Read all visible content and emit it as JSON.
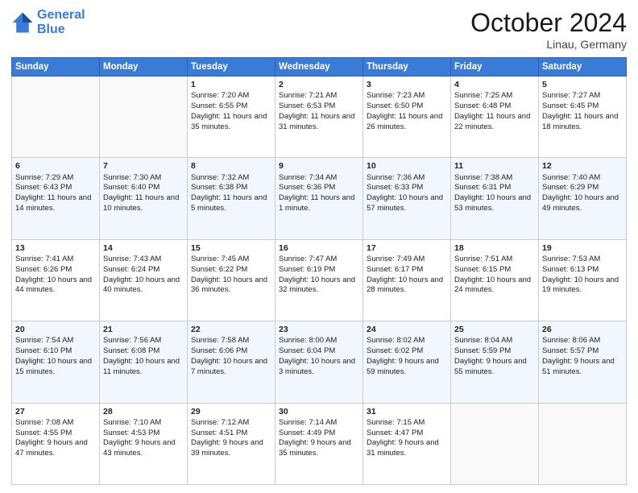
{
  "header": {
    "logo_line1": "General",
    "logo_line2": "Blue",
    "month": "October 2024",
    "location": "Linau, Germany"
  },
  "days_of_week": [
    "Sunday",
    "Monday",
    "Tuesday",
    "Wednesday",
    "Thursday",
    "Friday",
    "Saturday"
  ],
  "weeks": [
    [
      {
        "day": "",
        "sunrise": "",
        "sunset": "",
        "daylight": ""
      },
      {
        "day": "",
        "sunrise": "",
        "sunset": "",
        "daylight": ""
      },
      {
        "day": "1",
        "sunrise": "Sunrise: 7:20 AM",
        "sunset": "Sunset: 6:55 PM",
        "daylight": "Daylight: 11 hours and 35 minutes."
      },
      {
        "day": "2",
        "sunrise": "Sunrise: 7:21 AM",
        "sunset": "Sunset: 6:53 PM",
        "daylight": "Daylight: 11 hours and 31 minutes."
      },
      {
        "day": "3",
        "sunrise": "Sunrise: 7:23 AM",
        "sunset": "Sunset: 6:50 PM",
        "daylight": "Daylight: 11 hours and 26 minutes."
      },
      {
        "day": "4",
        "sunrise": "Sunrise: 7:25 AM",
        "sunset": "Sunset: 6:48 PM",
        "daylight": "Daylight: 11 hours and 22 minutes."
      },
      {
        "day": "5",
        "sunrise": "Sunrise: 7:27 AM",
        "sunset": "Sunset: 6:45 PM",
        "daylight": "Daylight: 11 hours and 18 minutes."
      }
    ],
    [
      {
        "day": "6",
        "sunrise": "Sunrise: 7:29 AM",
        "sunset": "Sunset: 6:43 PM",
        "daylight": "Daylight: 11 hours and 14 minutes."
      },
      {
        "day": "7",
        "sunrise": "Sunrise: 7:30 AM",
        "sunset": "Sunset: 6:40 PM",
        "daylight": "Daylight: 11 hours and 10 minutes."
      },
      {
        "day": "8",
        "sunrise": "Sunrise: 7:32 AM",
        "sunset": "Sunset: 6:38 PM",
        "daylight": "Daylight: 11 hours and 5 minutes."
      },
      {
        "day": "9",
        "sunrise": "Sunrise: 7:34 AM",
        "sunset": "Sunset: 6:36 PM",
        "daylight": "Daylight: 11 hours and 1 minute."
      },
      {
        "day": "10",
        "sunrise": "Sunrise: 7:36 AM",
        "sunset": "Sunset: 6:33 PM",
        "daylight": "Daylight: 10 hours and 57 minutes."
      },
      {
        "day": "11",
        "sunrise": "Sunrise: 7:38 AM",
        "sunset": "Sunset: 6:31 PM",
        "daylight": "Daylight: 10 hours and 53 minutes."
      },
      {
        "day": "12",
        "sunrise": "Sunrise: 7:40 AM",
        "sunset": "Sunset: 6:29 PM",
        "daylight": "Daylight: 10 hours and 49 minutes."
      }
    ],
    [
      {
        "day": "13",
        "sunrise": "Sunrise: 7:41 AM",
        "sunset": "Sunset: 6:26 PM",
        "daylight": "Daylight: 10 hours and 44 minutes."
      },
      {
        "day": "14",
        "sunrise": "Sunrise: 7:43 AM",
        "sunset": "Sunset: 6:24 PM",
        "daylight": "Daylight: 10 hours and 40 minutes."
      },
      {
        "day": "15",
        "sunrise": "Sunrise: 7:45 AM",
        "sunset": "Sunset: 6:22 PM",
        "daylight": "Daylight: 10 hours and 36 minutes."
      },
      {
        "day": "16",
        "sunrise": "Sunrise: 7:47 AM",
        "sunset": "Sunset: 6:19 PM",
        "daylight": "Daylight: 10 hours and 32 minutes."
      },
      {
        "day": "17",
        "sunrise": "Sunrise: 7:49 AM",
        "sunset": "Sunset: 6:17 PM",
        "daylight": "Daylight: 10 hours and 28 minutes."
      },
      {
        "day": "18",
        "sunrise": "Sunrise: 7:51 AM",
        "sunset": "Sunset: 6:15 PM",
        "daylight": "Daylight: 10 hours and 24 minutes."
      },
      {
        "day": "19",
        "sunrise": "Sunrise: 7:53 AM",
        "sunset": "Sunset: 6:13 PM",
        "daylight": "Daylight: 10 hours and 19 minutes."
      }
    ],
    [
      {
        "day": "20",
        "sunrise": "Sunrise: 7:54 AM",
        "sunset": "Sunset: 6:10 PM",
        "daylight": "Daylight: 10 hours and 15 minutes."
      },
      {
        "day": "21",
        "sunrise": "Sunrise: 7:56 AM",
        "sunset": "Sunset: 6:08 PM",
        "daylight": "Daylight: 10 hours and 11 minutes."
      },
      {
        "day": "22",
        "sunrise": "Sunrise: 7:58 AM",
        "sunset": "Sunset: 6:06 PM",
        "daylight": "Daylight: 10 hours and 7 minutes."
      },
      {
        "day": "23",
        "sunrise": "Sunrise: 8:00 AM",
        "sunset": "Sunset: 6:04 PM",
        "daylight": "Daylight: 10 hours and 3 minutes."
      },
      {
        "day": "24",
        "sunrise": "Sunrise: 8:02 AM",
        "sunset": "Sunset: 6:02 PM",
        "daylight": "Daylight: 9 hours and 59 minutes."
      },
      {
        "day": "25",
        "sunrise": "Sunrise: 8:04 AM",
        "sunset": "Sunset: 5:59 PM",
        "daylight": "Daylight: 9 hours and 55 minutes."
      },
      {
        "day": "26",
        "sunrise": "Sunrise: 8:06 AM",
        "sunset": "Sunset: 5:57 PM",
        "daylight": "Daylight: 9 hours and 51 minutes."
      }
    ],
    [
      {
        "day": "27",
        "sunrise": "Sunrise: 7:08 AM",
        "sunset": "Sunset: 4:55 PM",
        "daylight": "Daylight: 9 hours and 47 minutes."
      },
      {
        "day": "28",
        "sunrise": "Sunrise: 7:10 AM",
        "sunset": "Sunset: 4:53 PM",
        "daylight": "Daylight: 9 hours and 43 minutes."
      },
      {
        "day": "29",
        "sunrise": "Sunrise: 7:12 AM",
        "sunset": "Sunset: 4:51 PM",
        "daylight": "Daylight: 9 hours and 39 minutes."
      },
      {
        "day": "30",
        "sunrise": "Sunrise: 7:14 AM",
        "sunset": "Sunset: 4:49 PM",
        "daylight": "Daylight: 9 hours and 35 minutes."
      },
      {
        "day": "31",
        "sunrise": "Sunrise: 7:15 AM",
        "sunset": "Sunset: 4:47 PM",
        "daylight": "Daylight: 9 hours and 31 minutes."
      },
      {
        "day": "",
        "sunrise": "",
        "sunset": "",
        "daylight": ""
      },
      {
        "day": "",
        "sunrise": "",
        "sunset": "",
        "daylight": ""
      }
    ]
  ]
}
